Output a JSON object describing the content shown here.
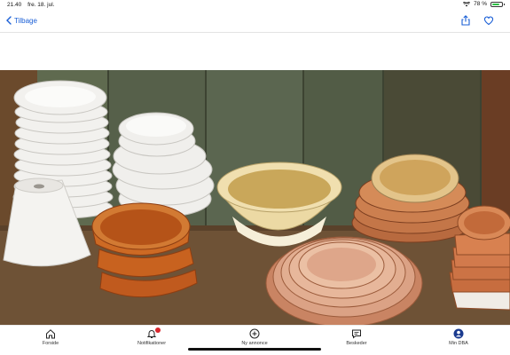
{
  "status_bar": {
    "time": "21.40",
    "date": "fre. 18. jul.",
    "battery_percent": "78 %",
    "battery_level": 0.78,
    "colors": {
      "battery": "#2fbf46"
    }
  },
  "nav": {
    "back_label": "Tilbage",
    "accent": "#1a5fd6",
    "actions": [
      "share-icon",
      "heart-icon"
    ]
  },
  "photo": {
    "subject": "listing-photo"
  },
  "tabbar": {
    "tabs": [
      {
        "label": "Forside",
        "icon": "home-icon"
      },
      {
        "label": "Notifikationer",
        "icon": "bell-icon"
      },
      {
        "label": "Ny annonce",
        "icon": "plus-circle-icon"
      },
      {
        "label": "Beskeder",
        "icon": "chat-icon"
      },
      {
        "label": "Min DBA",
        "icon": "profile-icon"
      }
    ],
    "badge_color": "#d9262c",
    "active_index": 4
  }
}
